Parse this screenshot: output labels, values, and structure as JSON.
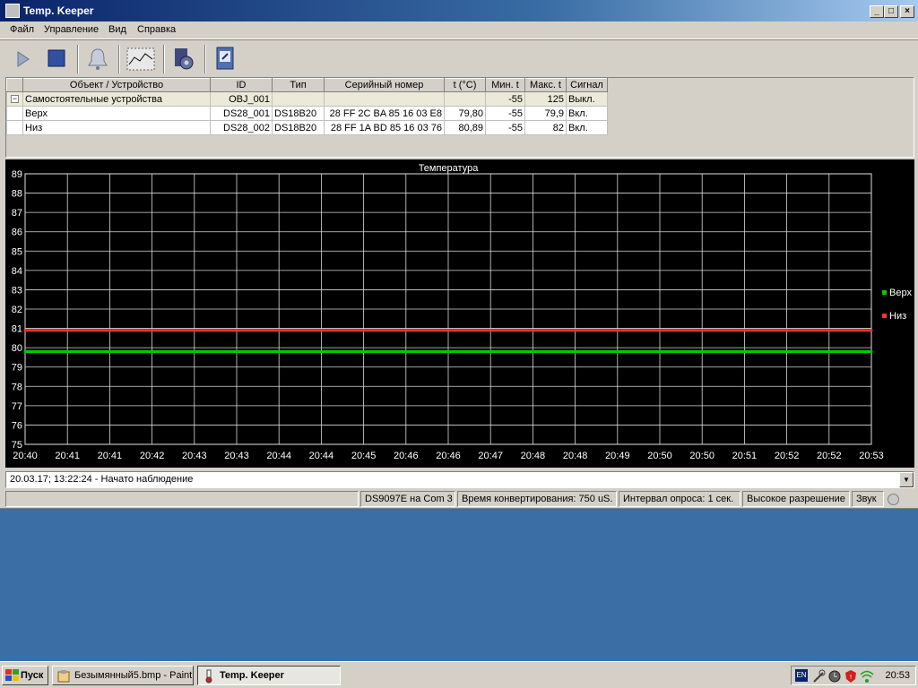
{
  "window": {
    "title": "Temp. Keeper",
    "controls": [
      "_",
      "□",
      "×"
    ]
  },
  "menu": [
    "Файл",
    "Управление",
    "Вид",
    "Справка"
  ],
  "toolbar": {
    "icons": [
      "play-icon",
      "stop-icon",
      "bell-icon",
      "chart-icon",
      "settings-icon",
      "export-icon"
    ]
  },
  "table": {
    "headers": [
      "Объект / Устройство",
      "ID",
      "Тип",
      "Серийный номер",
      "t (°C)",
      "Мин. t",
      "Макс. t",
      "Сигнал"
    ],
    "rows": [
      {
        "expander": "−",
        "name": "Самостоятельные устройства",
        "id": "OBJ_001",
        "type": "",
        "serial": "",
        "t": "",
        "min": "-55",
        "max": "125",
        "signal": "Выкл."
      },
      {
        "expander": "",
        "name": "Верх",
        "id": "DS28_001",
        "type": "DS18B20",
        "serial": "28 FF 2C BA 85 16 03 E8",
        "t": "79,80",
        "min": "-55",
        "max": "79,9",
        "signal": "Вкл."
      },
      {
        "expander": "",
        "name": "Низ",
        "id": "DS28_002",
        "type": "DS18B20",
        "serial": "28 FF 1A BD 85 16 03 76",
        "t": "80,89",
        "min": "-55",
        "max": "82",
        "signal": "Вкл."
      }
    ]
  },
  "chart_data": {
    "type": "line",
    "title": "Температура",
    "ylim": [
      75,
      89
    ],
    "yticks": [
      89,
      88,
      87,
      86,
      85,
      84,
      83,
      82,
      81,
      80,
      79,
      78,
      77,
      76,
      75
    ],
    "xticks": [
      "20:40",
      "20:41",
      "20:41",
      "20:42",
      "20:43",
      "20:43",
      "20:44",
      "20:44",
      "20:45",
      "20:46",
      "20:46",
      "20:47",
      "20:48",
      "20:48",
      "20:49",
      "20:50",
      "20:50",
      "20:51",
      "20:52",
      "20:52",
      "20:53"
    ],
    "grid": true,
    "legend_position": "right",
    "series": [
      {
        "name": "Верх",
        "color": "#00cc00",
        "values": [
          79.8,
          79.8,
          79.8,
          79.8,
          79.8,
          79.8,
          79.8,
          79.8,
          79.8,
          79.8,
          79.8,
          79.8,
          79.8,
          79.8,
          79.8,
          79.8,
          79.8,
          79.8,
          79.8,
          79.8,
          79.8
        ]
      },
      {
        "name": "Низ",
        "color": "#ff3030",
        "values": [
          80.9,
          80.9,
          80.9,
          80.9,
          80.9,
          80.9,
          80.9,
          80.9,
          80.9,
          80.9,
          80.9,
          80.9,
          80.9,
          80.9,
          80.9,
          80.9,
          80.9,
          80.9,
          80.9,
          80.9,
          80.9
        ]
      }
    ]
  },
  "log": {
    "text": "20.03.17; 13:22:24 - Начато наблюдение"
  },
  "status": {
    "port": "DS9097E на Com 3",
    "convert": "Время конвертирования: 750 uS.",
    "interval": "Интервал опроса: 1 сек.",
    "resolution": "Высокое разрешение",
    "sound": "Звук"
  },
  "taskbar": {
    "start": "Пуск",
    "tasks": [
      {
        "label": "Безымянный5.bmp - Paint",
        "active": false
      },
      {
        "label": "Temp. Keeper",
        "active": true
      }
    ],
    "lang": "EN",
    "clock": "20:53"
  }
}
